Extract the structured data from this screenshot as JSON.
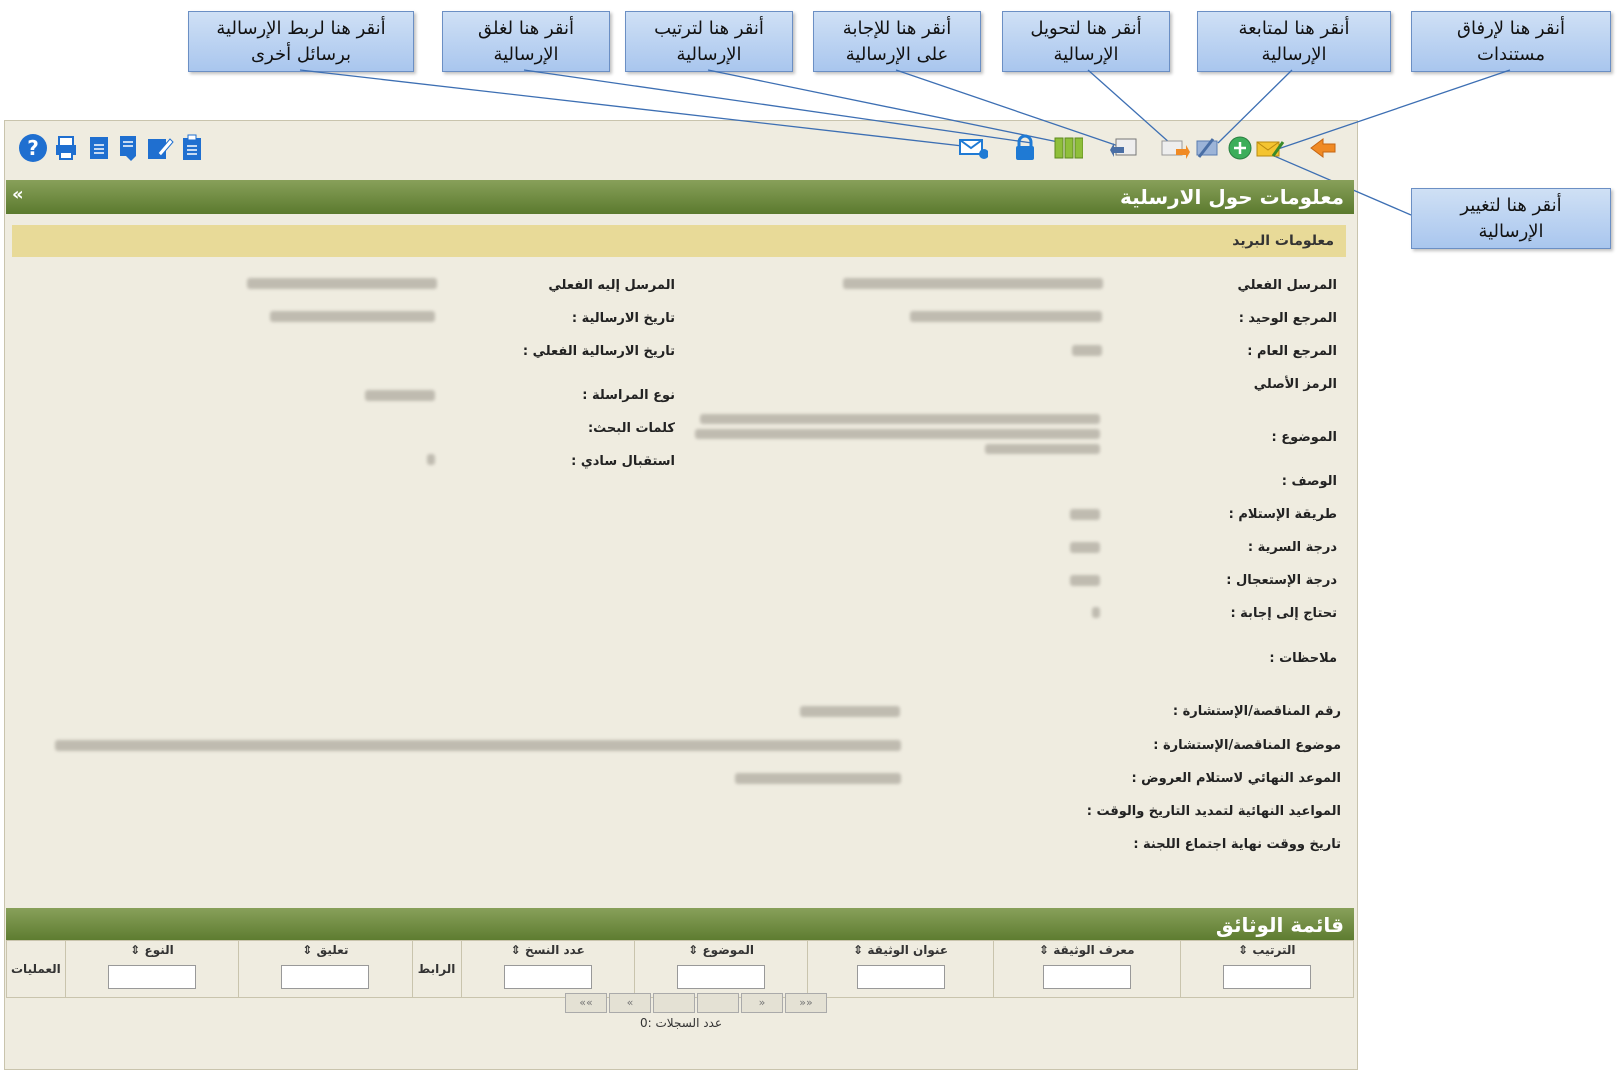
{
  "callouts": {
    "attach": [
      "أنقر هنا لإرفاق",
      "مستندات"
    ],
    "follow": [
      "أنقر هنا لمتابعة",
      "الإرسالية"
    ],
    "forward": [
      "أنقر هنا لتحويل",
      "الإرسالية"
    ],
    "reply": [
      "أنقر هنا للإجابة",
      "على الإرسالية"
    ],
    "sort": [
      "أنقر هنا لترتيب",
      "الإرسالية"
    ],
    "close": [
      "أنقر هنا لغلق",
      "الإرسالية"
    ],
    "link": [
      "أنقر هنا لربط الإرسالية",
      "برسائل أخرى"
    ],
    "change": [
      "أنقر هنا لتغيير",
      "الإرسالية"
    ]
  },
  "toolbar_icons_right": [
    "back-arrow-icon",
    "change-mail-icon",
    "add-icon",
    "follow-icon",
    "forward-icon",
    "reply-icon",
    "sort-icon",
    "lock-icon",
    "link-mail-icon"
  ],
  "toolbar_icons_left": [
    "help-icon",
    "print-icon",
    "document-icon",
    "document-list-icon",
    "edit-icon",
    "clipboard-icon"
  ],
  "info_section": {
    "title": "معلومات حول الارسلية",
    "collapse": "»",
    "subheader": "معلومات البريد"
  },
  "labels_right": {
    "sender": "المرسل الفعلي",
    "ref_unique": "المرجع الوحيد :",
    "ref_general": "المرجع العام :",
    "original_code": "الرمز الأصلي",
    "subject": "الموضوع :",
    "description": "الوصف :",
    "receive_method": "طريقة الإستلام :",
    "secrecy": "درجة السرية :",
    "urgency": "درجة الإستعجال :",
    "needs_reply": "تحتاج إلى إجابة :",
    "notes": "ملاحظات :"
  },
  "labels_mid": {
    "recipient": "المرسل إليه الفعلي",
    "date": "تاريخ الارسالية :",
    "actual_date": "تاريخ الارسالية الفعلي :",
    "corr_type": "نوع المراسلة :",
    "keywords": "كلمات البحث:",
    "regular": "استقبال سادي :"
  },
  "labels_tender": {
    "number": "رقم المناقصة/الإستشارة :",
    "subject": "موضوع المناقصة/الإستشارة :",
    "deadline": "الموعد النهائي لاستلام العروض :",
    "extensions": "المواعيد النهائية لتمديد التاريخ والوقت :",
    "committee": "تاريخ ووقت نهاية اجتماع اللجنة :"
  },
  "docs_section": {
    "title": "قائمة الوثائق",
    "columns": [
      "الترتيب ⇕",
      "معرف الوثيقة ⇕",
      "عنوان الوثيقة ⇕",
      "الموضوع ⇕",
      "عدد النسخ ⇕",
      "الرابط",
      "تعليق ⇕",
      "النوع ⇕",
      "العمليات"
    ],
    "filter_columns": [
      true,
      true,
      true,
      true,
      true,
      false,
      true,
      true,
      false
    ],
    "pager": [
      "««",
      "«",
      "",
      "",
      "»",
      "»»"
    ],
    "count_label": "عدد السجلات :0"
  }
}
